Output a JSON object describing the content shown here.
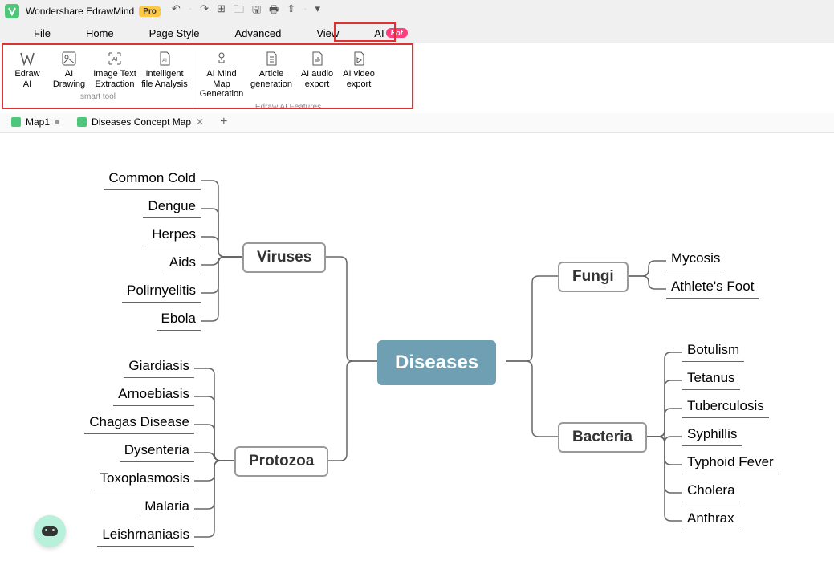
{
  "app": {
    "title": "Wondershare EdrawMind",
    "pro": "Pro"
  },
  "menus": {
    "file": "File",
    "home": "Home",
    "pageStyle": "Page Style",
    "advanced": "Advanced",
    "view": "View",
    "ai": "AI",
    "hot": "Hot"
  },
  "ribbon": {
    "group1_label": "smart tool",
    "group2_label": "Edraw AI Features",
    "btns": {
      "edrawAI": {
        "l1": "Edraw",
        "l2": "AI"
      },
      "aiDrawing": {
        "l1": "AI",
        "l2": "Drawing"
      },
      "imgText": {
        "l1": "Image Text",
        "l2": "Extraction"
      },
      "fileAnalysis": {
        "l1": "Intelligent",
        "l2": "file Analysis"
      },
      "mindmap": {
        "l1": "AI Mind Map",
        "l2": "Generation"
      },
      "article": {
        "l1": "Article",
        "l2": "generation"
      },
      "audio": {
        "l1": "AI audio",
        "l2": "export"
      },
      "video": {
        "l1": "AI video",
        "l2": "export"
      }
    }
  },
  "tabs": {
    "t1": "Map1",
    "t2": "Diseases Concept Map"
  },
  "mindmap": {
    "root": "Diseases",
    "branches": {
      "viruses": {
        "label": "Viruses",
        "leaves": [
          "Common Cold",
          "Dengue",
          "Herpes",
          "Aids",
          "Polirnyelitis",
          "Ebola"
        ]
      },
      "protozoa": {
        "label": "Protozoa",
        "leaves": [
          "Giardiasis",
          "Arnoebiasis",
          "Chagas Disease",
          "Dysenteria",
          "Toxoplasmosis",
          "Malaria",
          "Leishrnaniasis"
        ]
      },
      "fungi": {
        "label": "Fungi",
        "leaves": [
          "Mycosis",
          "Athlete's Foot"
        ]
      },
      "bacteria": {
        "label": "Bacteria",
        "leaves": [
          "Botulism",
          "Tetanus",
          "Tuberculosis",
          "Syphillis",
          "Typhoid Fever",
          "Cholera",
          "Anthrax"
        ]
      }
    }
  }
}
